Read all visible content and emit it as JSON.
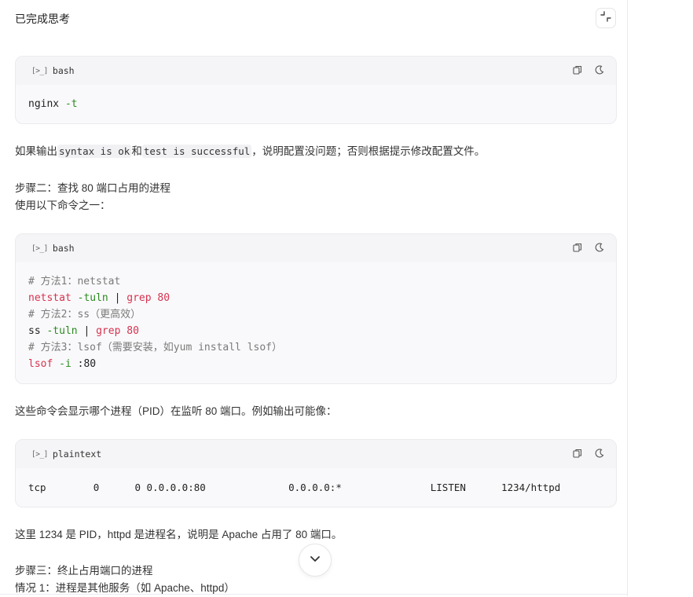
{
  "header": {
    "title": "已完成思考"
  },
  "codeblocks": [
    {
      "lang": "bash",
      "term_glyph": "[>_]"
    },
    {
      "lang": "bash",
      "term_glyph": "[>_]"
    },
    {
      "lang": "plaintext",
      "term_glyph": "[>_]"
    }
  ],
  "code1": {
    "cmd": "nginx",
    "flag": " -t"
  },
  "para1": {
    "before": "如果输出",
    "code1": "syntax is ok",
    "mid": "和",
    "code2": "test is successful",
    "after": "，说明配置没问题；否则根据提示修改配置文件。"
  },
  "step2": {
    "title": "步骤二：查找 80 端口占用的进程",
    "subtitle": "使用以下命令之一："
  },
  "code2": {
    "c1": "# 方法1：netstat",
    "l2a": "netstat",
    "l2b": " -tuln",
    "l2c": " | ",
    "l2d": "grep",
    "l2e": " 80",
    "c3": "# 方法2：ss（更高效）",
    "l4a": "ss",
    "l4b": " -tuln",
    "l4c": " | ",
    "l4d": "grep",
    "l4e": " 80",
    "c5": "# 方法3：lsof（需要安装，如yum install lsof）",
    "l6a": "lsof",
    "l6b": " -i",
    "l6c": " :80"
  },
  "para2": "这些命令会显示哪个进程（PID）在监听 80 端口。例如输出可能像：",
  "code3": {
    "line": "tcp        0      0 0.0.0.0:80              0.0.0.0:*               LISTEN      1234/httpd"
  },
  "para3": "这里 1234 是 PID，httpd 是进程名，说明是 Apache 占用了 80 端口。",
  "step3": {
    "title": "步骤三：终止占用端口的进程",
    "subtitle": "情况 1：进程是其他服务（如 Apache、httpd）"
  },
  "icons": {
    "copy": "copy-icon",
    "theme": "moon-icon",
    "collapse": "collapse-icon",
    "scroll": "chevron-down-icon"
  }
}
